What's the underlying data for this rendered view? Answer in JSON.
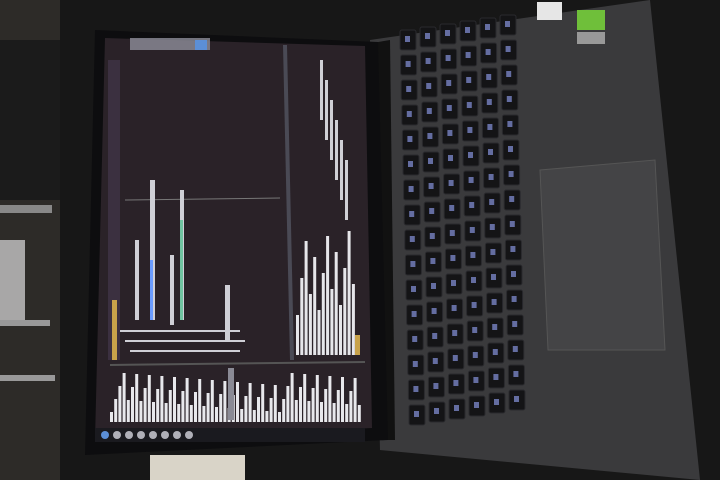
{
  "scene": {
    "subject": "laptop",
    "colors": {
      "wall": "#2b2a28",
      "desk": "#1a1a1a",
      "laptop_body": "#3a3a3c",
      "screen_bg": "#2a2228",
      "keyboard_backlight": "#9aa9ff",
      "sticker_green": "#6fbf3a",
      "sticker_white": "#e6e6e6"
    }
  },
  "screen": {
    "panels": [
      "left-pane",
      "middle-pane",
      "right-pane",
      "bottom-pane"
    ]
  },
  "keyboard": {
    "rows": 6,
    "backlight": "blue"
  },
  "taskbar": {
    "icons": [
      "start-icon",
      "search-icon",
      "files-icon",
      "browser-icon",
      "terminal-icon",
      "editor-icon",
      "settings-icon",
      "music-icon"
    ]
  }
}
